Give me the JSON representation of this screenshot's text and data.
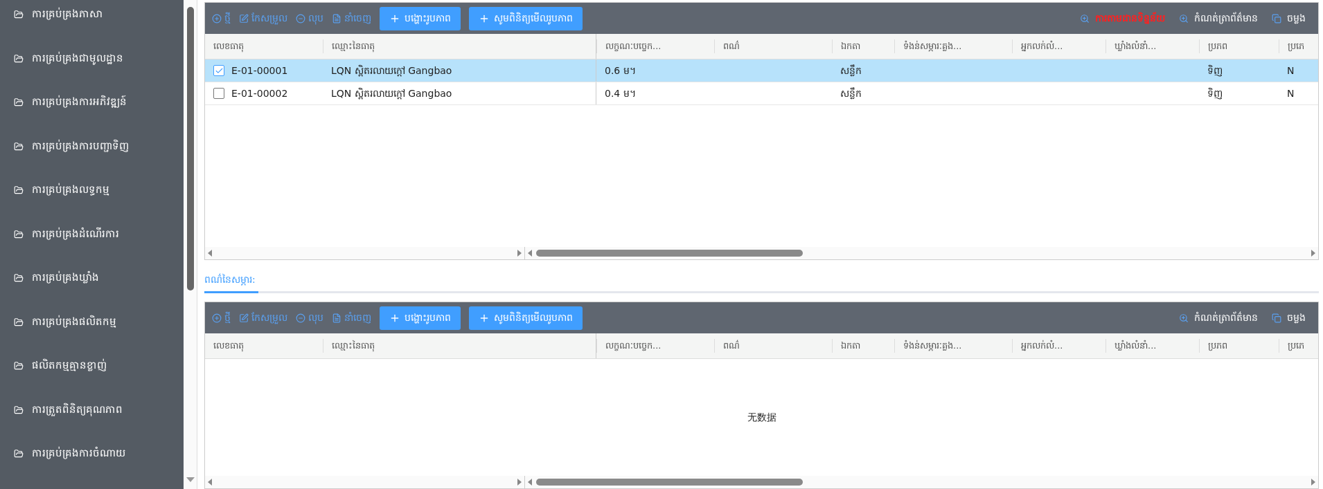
{
  "sidebar": {
    "items": [
      {
        "label": "ការគ្រប់គ្រងភាសា"
      },
      {
        "label": "ការគ្រប់គ្រងជាមូលដ្ឋាន"
      },
      {
        "label": "ការគ្រប់គ្រងការអភិវឌ្ឍន៍"
      },
      {
        "label": "ការគ្រប់គ្រងការបញ្ជាទិញ"
      },
      {
        "label": "ការគ្រប់គ្រងលទ្ធកម្ម"
      },
      {
        "label": "ការគ្រប់គ្រងដំណើរការ"
      },
      {
        "label": "ការគ្រប់គ្រងឃ្លាំង"
      },
      {
        "label": "ការគ្រប់គ្រងផលិតកម្ម"
      },
      {
        "label": "ផលិតកម្មគ្មានខ្លាញ់"
      },
      {
        "label": "ការត្រួតពិនិត្យគុណភាព"
      },
      {
        "label": "ការគ្រប់គ្រងការចំណាយ"
      }
    ]
  },
  "top_grid": {
    "toolbar": {
      "actions": [
        {
          "kind": "add",
          "label": "ថ្មី"
        },
        {
          "kind": "edit",
          "label": "កែសម្រួល"
        },
        {
          "kind": "delete",
          "label": "លុប"
        },
        {
          "kind": "export",
          "label": "នាំចេញ"
        }
      ],
      "buttons": [
        "បង្ហោះរូបភាព",
        "សូមពិនិត្យមើលរូបភាព"
      ],
      "right_actions": [
        {
          "kind": "zoom",
          "label": "ការតាមដានទិន្នន័យ",
          "highlighted": true
        },
        {
          "kind": "zoom",
          "label": "កំណត់ត្រាព័ត៌មាន",
          "highlighted": false
        },
        {
          "kind": "copy",
          "label": "ចម្លង",
          "highlighted": false
        }
      ]
    },
    "columns": [
      "លេខធាតុ",
      "ឈ្មោះនៃធាតុ",
      "លក្ខណៈបច្ចេក...",
      "ពណ៌",
      "ឯកតា",
      "ទំងន់សម្ភារៈគ្លង...",
      "អ្នកលក់លំ...",
      "ឃ្លាំងលំនាំ...",
      "ប្រភព",
      "ប្រភេ"
    ],
    "rows": [
      {
        "selected": true,
        "item_no": "E-01-00001",
        "name": "LQN ស្ពិតរលាយក្តៅ Gangbao",
        "spec": "0.6 ម។",
        "unit": "សន្លឹក",
        "source": "ទិញ",
        "type": "N"
      },
      {
        "selected": false,
        "item_no": "E-01-00002",
        "name": "LQN ស្ពិតរលាយក្តៅ Gangbao",
        "spec": "0.4 ម។",
        "unit": "សន្លឹក",
        "source": "ទិញ",
        "type": "N"
      }
    ]
  },
  "tabs": [
    {
      "label": "ពណ៌នៃសម្ភារ:",
      "selected": true
    }
  ],
  "bottom_grid": {
    "toolbar": {
      "actions": [
        {
          "kind": "add",
          "label": "ថ្មី"
        },
        {
          "kind": "edit",
          "label": "កែសម្រួល"
        },
        {
          "kind": "delete",
          "label": "លុប"
        },
        {
          "kind": "export",
          "label": "នាំចេញ"
        }
      ],
      "buttons": [
        "បង្ហោះរូបភាព",
        "សូមពិនិត្យមើលរូបភាព"
      ],
      "right_actions": [
        {
          "kind": "zoom",
          "label": "កំណត់ត្រាព័ត៌មាន",
          "highlighted": false
        },
        {
          "kind": "copy",
          "label": "ចម្លង",
          "highlighted": false
        }
      ]
    },
    "columns": [
      "លេខធាតុ",
      "ឈ្មោះនៃធាតុ",
      "លក្ខណៈបច្ចេក...",
      "ពណ៌",
      "ឯកតា",
      "ទំងន់សម្ភារៈគ្លង...",
      "អ្នកលក់លំ...",
      "ឃ្លាំងលំនាំ...",
      "ប្រភព",
      "ប្រភេ"
    ],
    "empty_text": "无数据"
  }
}
